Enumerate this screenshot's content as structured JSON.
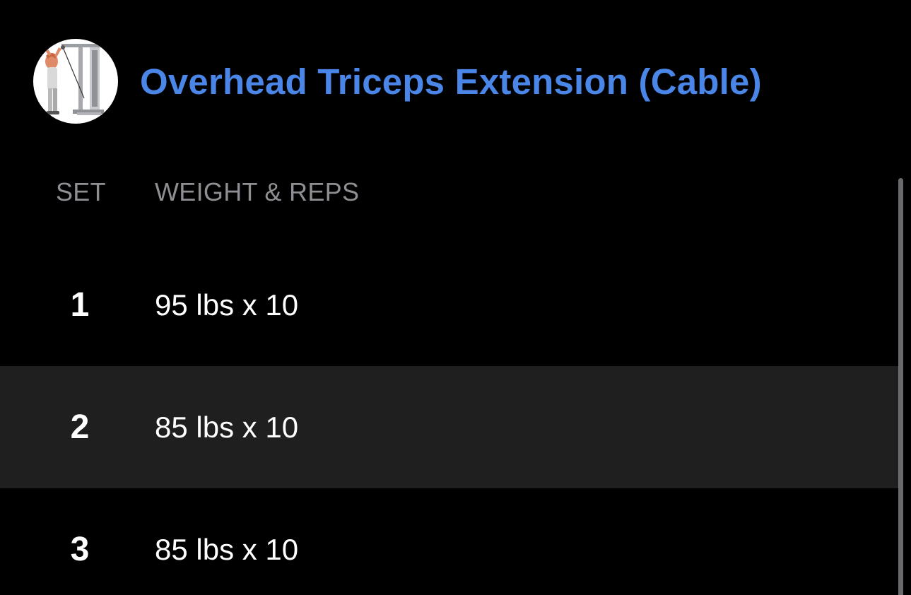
{
  "exercise": {
    "title": "Overhead Triceps Extension (Cable)",
    "thumbnail_icon": "cable-triceps-extension-illustration",
    "title_color": "#4a86e8"
  },
  "table": {
    "headers": {
      "set": "SET",
      "weight_reps": "WEIGHT & REPS"
    },
    "rows": [
      {
        "set": "1",
        "value": "95 lbs x 10"
      },
      {
        "set": "2",
        "value": "85 lbs x 10"
      },
      {
        "set": "3",
        "value": "85 lbs x 10"
      }
    ]
  },
  "colors": {
    "background": "#000000",
    "row_highlight": "#1f1f20",
    "header_text": "#8e8e93",
    "value_text": "#ffffff"
  }
}
